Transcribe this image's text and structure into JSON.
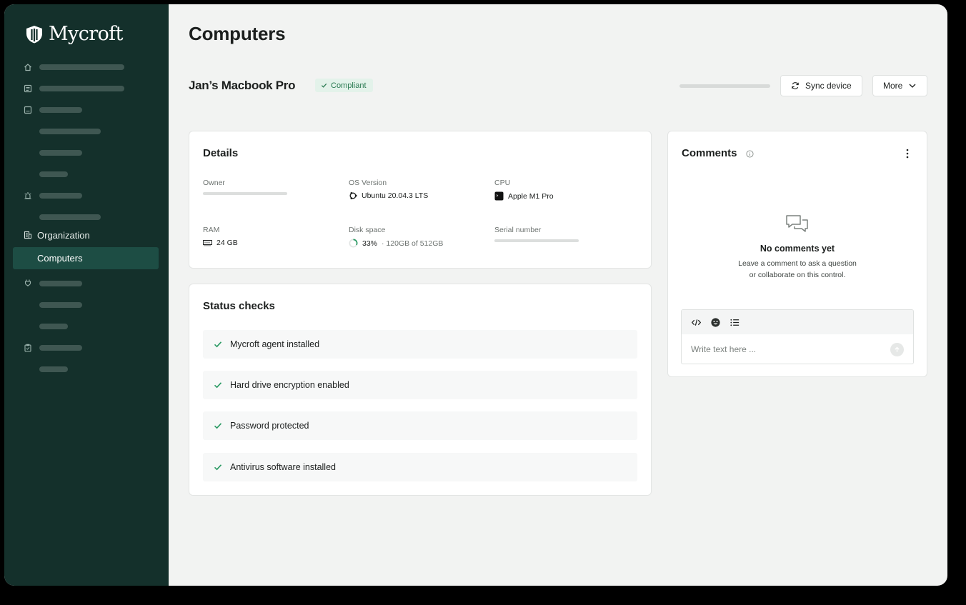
{
  "app": {
    "brand": "Mycroft"
  },
  "colors": {
    "sidebar_bg": "#14302b",
    "active_nav": "#1d4d44",
    "accent_green": "#2a7a52"
  },
  "sidebar": {
    "section_label": "Organization",
    "active_item": "Computers"
  },
  "page": {
    "title": "Computers",
    "device_name": "Jan’s Macbook Pro",
    "badge": "Compliant",
    "sync_button": "Sync device",
    "more_button": "More"
  },
  "details": {
    "title": "Details",
    "owner_label": "Owner",
    "os_label": "OS Version",
    "os_value": "Ubuntu 20.04.3 LTS",
    "cpu_label": "CPU",
    "cpu_value": "Apple M1 Pro",
    "ram_label": "RAM",
    "ram_value": "24 GB",
    "disk_label": "Disk space",
    "disk_percent": "33%",
    "disk_detail": "· 120GB of 512GB",
    "disk_fraction": 0.33,
    "serial_label": "Serial number"
  },
  "status_checks": {
    "title": "Status checks",
    "items": [
      {
        "label": "Mycroft agent installed"
      },
      {
        "label": "Hard drive encryption enabled"
      },
      {
        "label": "Password protected"
      },
      {
        "label": "Antivirus software installed"
      }
    ]
  },
  "comments": {
    "title": "Comments",
    "empty_title": "No comments yet",
    "empty_line1": "Leave a comment to ask a question",
    "empty_line2": "or collaborate on this control.",
    "input_placeholder": "Write text here ..."
  }
}
